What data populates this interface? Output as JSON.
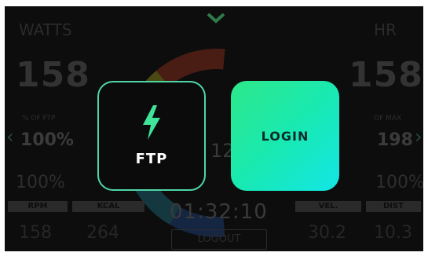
{
  "background": {
    "watts_label": "WATTS",
    "hr_label": "HR",
    "watts_value": "158",
    "hr_value": "158",
    "ftp_pct_label": "% OF FTP",
    "ftp_pct_value": "100%",
    "hr_max_label": "OF MAX",
    "hr_max_value": "198",
    "left_pct": "100%",
    "right_pct": "100%",
    "center_value": "12",
    "rpm_label": "RPM",
    "kcal_label": "KCAL",
    "vel_label": "VEL.",
    "dist_label": "DIST",
    "rpm_value": "158",
    "kcal_value": "264",
    "vel_value": "30.2",
    "dist_value": "10.3",
    "timer": "01:32:10",
    "logout_label": "LOGOUT"
  },
  "tiles": {
    "ftp_label": "FTP",
    "login_label": "LOGIN"
  },
  "colors": {
    "accent_green": "#2ee88a",
    "accent_cyan": "#12e6e6",
    "ftp_border": "#4fd6a6"
  },
  "icons": {
    "ftp_icon": "lightning-bolt-icon",
    "top_chevron": "chevron-down-icon"
  }
}
